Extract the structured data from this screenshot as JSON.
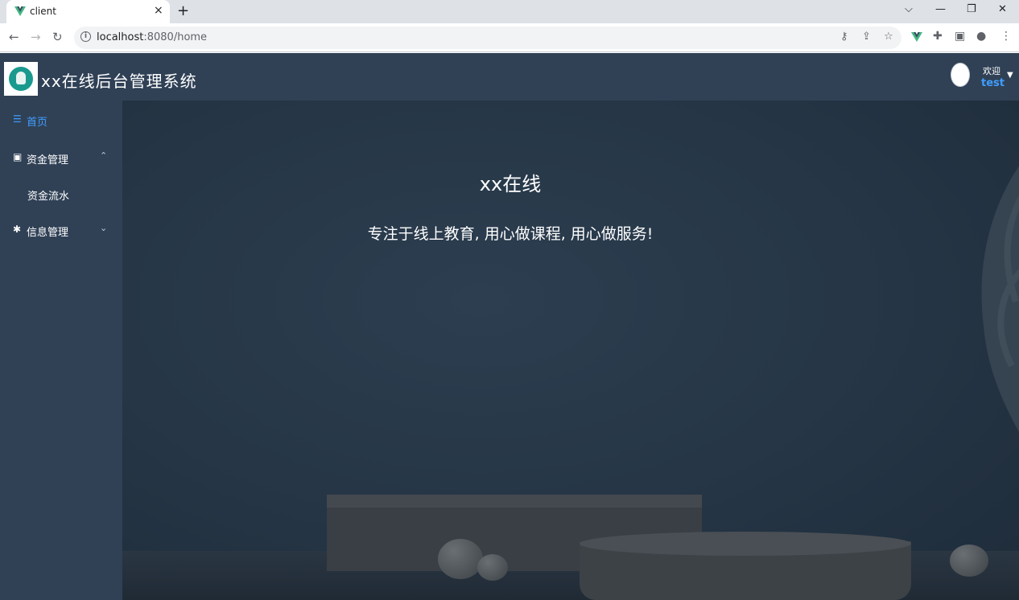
{
  "browser": {
    "tab_title": "client",
    "tab_close": "×",
    "new_tab": "+",
    "url_host": "localhost",
    "url_rest": ":8080/home",
    "controls": {
      "dropdown": "⌵",
      "minimize": "—",
      "restore": "❐",
      "close": "✕"
    }
  },
  "header": {
    "title": "xx在线后台管理系统",
    "welcome": "欢迎",
    "username": "test"
  },
  "sidebar": {
    "items": [
      {
        "label": "首页",
        "icon": "list-icon",
        "active": true
      },
      {
        "label": "资金管理",
        "icon": "money-icon",
        "expanded": true
      },
      {
        "label": "资金流水",
        "icon": "",
        "submenu": true
      },
      {
        "label": "信息管理",
        "icon": "gear-icon",
        "expanded": false
      }
    ]
  },
  "main": {
    "title": "xx在线",
    "subtitle": "专注于线上教育, 用心做课程, 用心做服务!"
  },
  "colors": {
    "accent": "#409eff",
    "sidebar_bg": "#304156",
    "header_bg": "#304156"
  }
}
